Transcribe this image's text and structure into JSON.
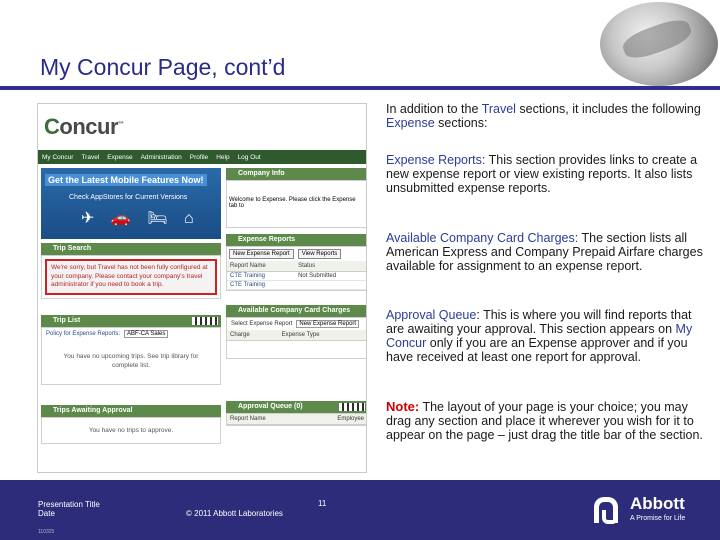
{
  "slide": {
    "title": "My Concur Page, cont’d"
  },
  "screenshot": {
    "logo": "Concur",
    "nav": [
      "My Concur",
      "Travel",
      "Expense",
      "Administration",
      "Profile",
      "Help",
      "Log Out"
    ],
    "banner": {
      "title": "Get the Latest Mobile Features Now!",
      "subtitle": "Check AppStores for Current Versions"
    },
    "trip_search": {
      "header": "Trip Search",
      "warning": "We're sorry, but Travel has not been fully configured at your company. Please contact your company's travel administrator if you need to book a trip."
    },
    "trip_list": {
      "header": "Trip List",
      "policy_label": "Policy for Expense Reports:",
      "policy_value": "ABF-CA Sales",
      "empty": "You have no upcoming trips. See trip library for complete list."
    },
    "trips_awaiting": {
      "header": "Trips Awaiting Approval",
      "empty": "You have no trips to approve."
    },
    "company_info": {
      "header": "Company Info",
      "text": "Welcome to Expense. Please click the Expense tab to"
    },
    "expense_reports": {
      "header": "Expense Reports",
      "new_btn": "New Expense Report",
      "view_btn": "View Reports",
      "col_name": "Report Name",
      "col_status": "Status",
      "rows": [
        {
          "name": "CTE Training",
          "status": "Not Submitted"
        },
        {
          "name": "CTE Training",
          "status": ""
        }
      ]
    },
    "company_card": {
      "header": "Available Company Card Charges",
      "select_label": "Select Expense Report",
      "select_value": "New Expense Report",
      "col_charge": "Charge",
      "col_type": "Expense Type"
    },
    "approval_queue": {
      "header": "Approval Queue",
      "count": "(0)",
      "col_report": "Report Name",
      "col_employee": "Employee"
    }
  },
  "content": {
    "intro_a": "In addition to the ",
    "intro_travel": "Travel",
    "intro_b": " sections, it includes the following ",
    "intro_expense": "Expense",
    "intro_c": " sections:",
    "er_label": "Expense Reports:",
    "er_text": " This section provides links to create a new expense report or view existing reports. It also lists unsubmitted expense reports.",
    "cc_label": "Available Company Card Charges:",
    "cc_text": " The section lists  all American Express and Company Prepaid Airfare charges available for assignment to an expense report.",
    "aq_label": "Approval Queue",
    "aq_colon": ":",
    "aq_text_a": " This is where you will find reports that are awaiting your approval. This section appears on ",
    "aq_myconcur": "My Concur",
    "aq_text_b": " only if you are an Expense approver and if you have received at least one report for approval.",
    "note_label": "Note:",
    "note_text": " The layout of your page is your choice; you may drag any section and place it wherever you wish for it to appear on the page – just drag the title bar of the section."
  },
  "footer": {
    "presentation_title": "Presentation Title",
    "date": "Date",
    "copyright": "© 2011 Abbott Laboratories",
    "page": "11",
    "code": "110325",
    "brand": "Abbott",
    "tagline": "A Promise for Life"
  },
  "colors": {
    "title": "#2a2a8a",
    "footer_bg": "#2c2c7a",
    "highlight_blue": "#2a3d9a",
    "note_red": "#cc0000"
  }
}
